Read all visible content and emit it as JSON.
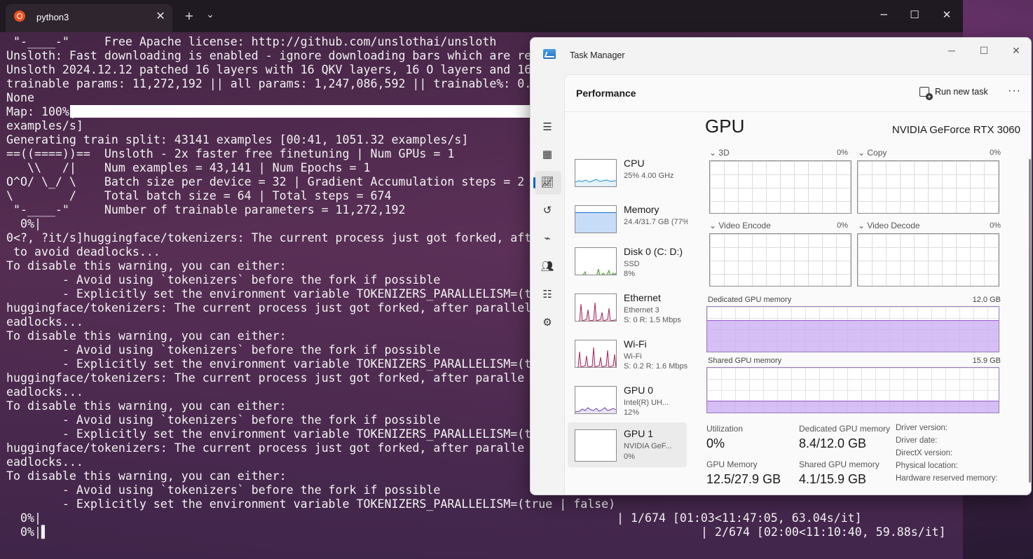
{
  "terminal": {
    "tab_title": "python3",
    "tab_close": "✕",
    "new_tab": "+",
    "dropdown": "⌄",
    "lines": [
      " \"-____-\"     Free Apache license: http://github.com/unslothai/unsloth",
      "Unsloth: Fast downloading is enabled - ignore downloading bars which are re",
      "Unsloth 2024.12.12 patched 16 layers with 16 QKV layers, 16 O layers and 16",
      "trainable params: 11,272,192 || all params: 1,247,086,592 || trainable%: 0.",
      "None",
      "Map: 100%|",
      "examples/s]",
      "Generating train split: 43141 examples [00:41, 1051.32 examples/s]",
      "==((====))==  Unsloth - 2x faster free finetuning | Num GPUs = 1",
      "   \\\\   /|    Num examples = 43,141 | Num Epochs = 1",
      "O^O/ \\_/ \\    Batch size per device = 32 | Gradient Accumulation steps = 2",
      "\\        /    Total batch size = 64 | Total steps = 674",
      " \"-____-\"     Number of trainable parameters = 11,272,192",
      "  0%|",
      "0<?, ?it/s]huggingface/tokenizers: The current process just got forked, aft",
      " to avoid deadlocks...",
      "To disable this warning, you can either:",
      "        - Avoid using `tokenizers` before the fork if possible",
      "        - Explicitly set the environment variable TOKENIZERS_PARALLELISM=(t",
      "huggingface/tokenizers: The current process just got forked, after parallel",
      "eadlocks...",
      "To disable this warning, you can either:",
      "        - Avoid using `tokenizers` before the fork if possible",
      "        - Explicitly set the environment variable TOKENIZERS_PARALLELISM=(t",
      "huggingface/tokenizers: The current process just got forked, after paralle",
      "eadlocks...",
      "To disable this warning, you can either:",
      "        - Avoid using `tokenizers` before the fork if possible",
      "        - Explicitly set the environment variable TOKENIZERS_PARALLELISM=(t",
      "huggingface/tokenizers: The current process just got forked, after paralle",
      "eadlocks...",
      "To disable this warning, you can either:",
      "        - Avoid using `tokenizers` before the fork if possible",
      "        - Explicitly set the environment variable TOKENIZERS_PARALLELISM=(true | false)",
      "  0%|",
      "  0%|▌"
    ],
    "progress_1": "| 1/674 [01:03<11:47:05, 63.04s/it]",
    "progress_2": "| 2/674 [02:00<11:10:40, 59.88s/it]"
  },
  "task_manager": {
    "title": "Task Manager",
    "page_title": "Performance",
    "run_new_task": "Run new task",
    "more": "···",
    "devices": [
      {
        "name": "CPU",
        "sub1": "25%  4.00 GHz",
        "sub2": "",
        "color": "#1b8fd1"
      },
      {
        "name": "Memory",
        "sub1": "24.4/31.7 GB (77%)",
        "sub2": "",
        "color": "#1b6fd1"
      },
      {
        "name": "Disk 0 (C: D:)",
        "sub1": "SSD",
        "sub2": "8%",
        "color": "#4c9a2a"
      },
      {
        "name": "Ethernet",
        "sub1": "Ethernet 3",
        "sub2": "S: 0  R: 1.5 Mbps",
        "color": "#a7285f"
      },
      {
        "name": "Wi-Fi",
        "sub1": "Wi-Fi",
        "sub2": "S: 0.2  R: 1.6 Mbps",
        "color": "#a7285f"
      },
      {
        "name": "GPU 0",
        "sub1": "Intel(R) UH...",
        "sub2": "12%",
        "color": "#6a3fb0"
      },
      {
        "name": "GPU 1",
        "sub1": "NVIDIA GeF...",
        "sub2": "0%",
        "color": "#6a3fb0"
      }
    ],
    "gpu": {
      "heading": "GPU",
      "model": "NVIDIA GeForce RTX 3060",
      "engines": [
        {
          "label": "3D",
          "pct": "0%"
        },
        {
          "label": "Copy",
          "pct": "0%"
        },
        {
          "label": "Video Encode",
          "pct": "0%"
        },
        {
          "label": "Video Decode",
          "pct": "0%"
        }
      ],
      "dedicated_label": "Dedicated GPU memory",
      "dedicated_max": "12.0 GB",
      "dedicated_fill": 0.7,
      "shared_label": "Shared GPU memory",
      "shared_max": "15.9 GB",
      "shared_fill": 0.26,
      "stats": {
        "utilization_label": "Utilization",
        "utilization_value": "0%",
        "dedicated_label": "Dedicated GPU memory",
        "dedicated_value": "8.4/12.0 GB",
        "gpu_memory_label": "GPU Memory",
        "gpu_memory_value": "12.5/27.9 GB",
        "shared_label": "Shared GPU memory",
        "shared_value": "4.1/15.9 GB"
      },
      "info_labels": [
        "Driver version:",
        "Driver date:",
        "DirectX version:",
        "Physical location:",
        "Hardware reserved memory:"
      ]
    }
  }
}
